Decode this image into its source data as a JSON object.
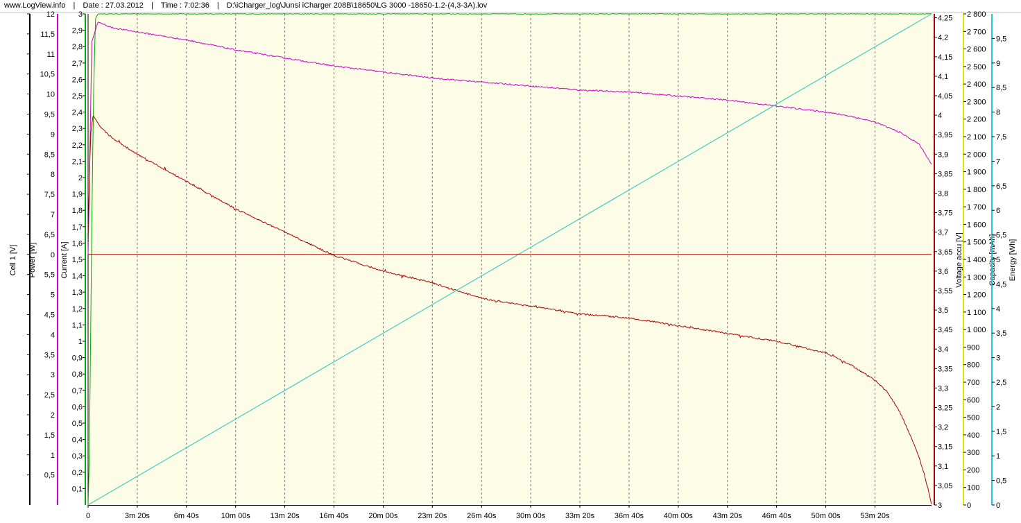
{
  "header": {
    "site": "www.LogView.info",
    "sep1": "|",
    "date": "Date : 27.03.2012",
    "sep2": "|",
    "time": "Time : 7:02:36",
    "sep3": "|",
    "file": "D:\\iCharger_log\\Junsi iCharger 208B\\18650\\LG 3000 -18650-1.2-(4,3-3A).lov"
  },
  "colors": {
    "plot_bg": "#fdfce6",
    "cell1": "#000000",
    "power": "#cc00cc",
    "current": "#00aa00",
    "voltage": "#aa0000",
    "capacity": "#e6e600",
    "energy": "#22c8e0",
    "cell1_line": "#aa0000",
    "grid": "#777777"
  },
  "chart_data": {
    "type": "line",
    "x_axis": {
      "unit": "s",
      "range": [
        0,
        3430
      ],
      "ticks": [
        {
          "value": 0,
          "label": "0"
        },
        {
          "value": 200,
          "label": "3m 20s"
        },
        {
          "value": 400,
          "label": "6m 40s"
        },
        {
          "value": 600,
          "label": "10m 00s"
        },
        {
          "value": 800,
          "label": "13m 20s"
        },
        {
          "value": 1000,
          "label": "16m 40s"
        },
        {
          "value": 1200,
          "label": "20m 00s"
        },
        {
          "value": 1400,
          "label": "23m 20s"
        },
        {
          "value": 1600,
          "label": "26m 40s"
        },
        {
          "value": 1800,
          "label": "30m 00s"
        },
        {
          "value": 2000,
          "label": "33m 20s"
        },
        {
          "value": 2200,
          "label": "36m 40s"
        },
        {
          "value": 2400,
          "label": "40m 00s"
        },
        {
          "value": 2600,
          "label": "43m 20s"
        },
        {
          "value": 2800,
          "label": "46m 40s"
        },
        {
          "value": 3000,
          "label": "50m 00s"
        },
        {
          "value": 3200,
          "label": "53m 20s"
        }
      ]
    },
    "axes": [
      {
        "id": "cell1",
        "title": "Cell 1 [V]",
        "side": "left",
        "color": "#000000",
        "range": [
          -0.25,
          12
        ],
        "ticks": [
          {
            "value": 12,
            "label": "12"
          },
          {
            "value": 11.5,
            "label": "11,5"
          },
          {
            "value": 11,
            "label": "11"
          },
          {
            "value": 10.5,
            "label": "10,5"
          },
          {
            "value": 10,
            "label": "10"
          },
          {
            "value": 9.5,
            "label": "9,5"
          },
          {
            "value": 9,
            "label": "9"
          },
          {
            "value": 8.5,
            "label": "8,5"
          },
          {
            "value": 8,
            "label": "8"
          },
          {
            "value": 7.5,
            "label": "7,5"
          },
          {
            "value": 7,
            "label": "7"
          },
          {
            "value": 6.5,
            "label": "6,5"
          },
          {
            "value": 6,
            "label": "0"
          },
          {
            "value": 5.5,
            "label": "5,5"
          },
          {
            "value": 5,
            "label": "5"
          },
          {
            "value": 4.5,
            "label": "4,5"
          },
          {
            "value": 4,
            "label": "4"
          },
          {
            "value": 3.5,
            "label": "3,5"
          },
          {
            "value": 3,
            "label": "3"
          },
          {
            "value": 2.5,
            "label": "2,5"
          },
          {
            "value": 2,
            "label": "2"
          },
          {
            "value": 1.5,
            "label": "1,5"
          },
          {
            "value": 1,
            "label": "1"
          },
          {
            "value": 0.5,
            "label": "0,5"
          }
        ]
      },
      {
        "id": "current",
        "title": "Current [A]",
        "side": "left",
        "color": "#00aa00",
        "range": [
          0,
          3
        ],
        "ticks": [
          {
            "value": 3,
            "label": "3"
          },
          {
            "value": 2.9,
            "label": "2,9"
          },
          {
            "value": 2.8,
            "label": "2,8"
          },
          {
            "value": 2.7,
            "label": "2,7"
          },
          {
            "value": 2.6,
            "label": "2,6"
          },
          {
            "value": 2.5,
            "label": "2,5"
          },
          {
            "value": 2.4,
            "label": "2,4"
          },
          {
            "value": 2.3,
            "label": "2,3"
          },
          {
            "value": 2.2,
            "label": "2,2"
          },
          {
            "value": 2.1,
            "label": "2,1"
          },
          {
            "value": 2,
            "label": "2"
          },
          {
            "value": 1.9,
            "label": "1,9"
          },
          {
            "value": 1.8,
            "label": "1,8"
          },
          {
            "value": 1.7,
            "label": "1,7"
          },
          {
            "value": 1.6,
            "label": "1,6"
          },
          {
            "value": 1.5,
            "label": "1,5"
          },
          {
            "value": 1.4,
            "label": "1,4"
          },
          {
            "value": 1.3,
            "label": "1,3"
          },
          {
            "value": 1.2,
            "label": "1,2"
          },
          {
            "value": 1.1,
            "label": "1,1"
          },
          {
            "value": 1,
            "label": "1"
          },
          {
            "value": 0.9,
            "label": "0,9"
          },
          {
            "value": 0.8,
            "label": "0,8"
          },
          {
            "value": 0.7,
            "label": "0,7"
          },
          {
            "value": 0.6,
            "label": "0,6"
          },
          {
            "value": 0.5,
            "label": "0,5"
          },
          {
            "value": 0.4,
            "label": "0,4"
          },
          {
            "value": 0.3,
            "label": "0,3"
          },
          {
            "value": 0.2,
            "label": "0,2"
          },
          {
            "value": 0.1,
            "label": "0,1"
          }
        ]
      },
      {
        "id": "power",
        "title": "Power [W]",
        "side": "left",
        "color": "#cc00cc",
        "range": [
          -0.25,
          12
        ],
        "ticks": []
      },
      {
        "id": "voltage",
        "title": "Voltage accu [V]",
        "side": "right",
        "color": "#aa0000",
        "range": [
          3,
          4.26
        ],
        "ticks": [
          {
            "value": 4.25,
            "label": "4,25"
          },
          {
            "value": 4.2,
            "label": "4,2"
          },
          {
            "value": 4.15,
            "label": "4,15"
          },
          {
            "value": 4.1,
            "label": "4,1"
          },
          {
            "value": 4.05,
            "label": "4,05"
          },
          {
            "value": 4,
            "label": "4"
          },
          {
            "value": 3.95,
            "label": "3,95"
          },
          {
            "value": 3.9,
            "label": "3,9"
          },
          {
            "value": 3.85,
            "label": "3,85"
          },
          {
            "value": 3.8,
            "label": "3,8"
          },
          {
            "value": 3.75,
            "label": "3,75"
          },
          {
            "value": 3.7,
            "label": "3,7"
          },
          {
            "value": 3.65,
            "label": "3,65"
          },
          {
            "value": 3.6,
            "label": "3,6"
          },
          {
            "value": 3.55,
            "label": "3,55"
          },
          {
            "value": 3.5,
            "label": "3,5"
          },
          {
            "value": 3.45,
            "label": "3,45"
          },
          {
            "value": 3.4,
            "label": "3,4"
          },
          {
            "value": 3.35,
            "label": "3,35"
          },
          {
            "value": 3.3,
            "label": "3,3"
          },
          {
            "value": 3.25,
            "label": "3,25"
          },
          {
            "value": 3.2,
            "label": "3,2"
          },
          {
            "value": 3.15,
            "label": "3,15"
          },
          {
            "value": 3.1,
            "label": "3,1"
          },
          {
            "value": 3.05,
            "label": "3,05"
          },
          {
            "value": 3,
            "label": "3"
          }
        ]
      },
      {
        "id": "capacity",
        "title": "Capacity [mAh]",
        "side": "right",
        "color": "#e6e600",
        "range": [
          0,
          2800
        ],
        "ticks": [
          {
            "value": 2800,
            "label": "2 800"
          },
          {
            "value": 2700,
            "label": "2 700"
          },
          {
            "value": 2600,
            "label": "2 600"
          },
          {
            "value": 2500,
            "label": "2 500"
          },
          {
            "value": 2400,
            "label": "2 400"
          },
          {
            "value": 2300,
            "label": "2 300"
          },
          {
            "value": 2200,
            "label": "2 200"
          },
          {
            "value": 2100,
            "label": "2 100"
          },
          {
            "value": 2000,
            "label": "2 000"
          },
          {
            "value": 1900,
            "label": "1 900"
          },
          {
            "value": 1800,
            "label": "1 800"
          },
          {
            "value": 1700,
            "label": "1 700"
          },
          {
            "value": 1600,
            "label": "1 600"
          },
          {
            "value": 1500,
            "label": "1 500"
          },
          {
            "value": 1400,
            "label": "1 400"
          },
          {
            "value": 1300,
            "label": "1 300"
          },
          {
            "value": 1200,
            "label": "1 200"
          },
          {
            "value": 1100,
            "label": "1 100"
          },
          {
            "value": 1000,
            "label": "1 000"
          },
          {
            "value": 900,
            "label": "900"
          },
          {
            "value": 800,
            "label": "800"
          },
          {
            "value": 700,
            "label": "700"
          },
          {
            "value": 600,
            "label": "600"
          },
          {
            "value": 500,
            "label": "500"
          },
          {
            "value": 400,
            "label": "400"
          },
          {
            "value": 300,
            "label": "300"
          },
          {
            "value": 200,
            "label": "200"
          },
          {
            "value": 100,
            "label": "100"
          },
          {
            "value": 0,
            "label": "0"
          }
        ]
      },
      {
        "id": "energy",
        "title": "Energy [Wh]",
        "side": "right",
        "color": "#22c8e0",
        "range": [
          0,
          10
        ],
        "ticks": [
          {
            "value": 9.5,
            "label": "9,5"
          },
          {
            "value": 9,
            "label": "9"
          },
          {
            "value": 8.5,
            "label": "8,5"
          },
          {
            "value": 8,
            "label": "8"
          },
          {
            "value": 7.5,
            "label": "7,5"
          },
          {
            "value": 7,
            "label": "7"
          },
          {
            "value": 6.5,
            "label": "6,5"
          },
          {
            "value": 6,
            "label": "6"
          },
          {
            "value": 5.5,
            "label": "5,5"
          },
          {
            "value": 5,
            "label": "5"
          },
          {
            "value": 4.5,
            "label": "4,5"
          },
          {
            "value": 4,
            "label": "4"
          },
          {
            "value": 3.5,
            "label": "3,5"
          },
          {
            "value": 3,
            "label": "3"
          },
          {
            "value": 2.5,
            "label": "2,5"
          },
          {
            "value": 2,
            "label": "2"
          },
          {
            "value": 1.5,
            "label": "1,5"
          },
          {
            "value": 1,
            "label": "1"
          },
          {
            "value": 0.5,
            "label": "0,5"
          },
          {
            "value": 0,
            "label": "0"
          }
        ]
      }
    ],
    "series": [
      {
        "id": "current",
        "axis": "current",
        "color": "#00aa00",
        "x": [
          0,
          5,
          10,
          15,
          20,
          25,
          30,
          40,
          3430
        ],
        "y": [
          0,
          0.3,
          1.0,
          1.7,
          2.3,
          2.7,
          2.97,
          3.0,
          3.0
        ]
      },
      {
        "id": "power",
        "axis": "power",
        "color": "#cc00cc",
        "x": [
          0,
          15,
          40,
          100,
          200,
          400,
          600,
          800,
          1000,
          1200,
          1400,
          1600,
          1800,
          2000,
          2200,
          2400,
          2600,
          2800,
          3000,
          3100,
          3200,
          3300,
          3380,
          3430
        ],
        "y": [
          6.0,
          11.3,
          11.8,
          11.65,
          11.55,
          11.35,
          11.1,
          10.9,
          10.7,
          10.55,
          10.4,
          10.3,
          10.2,
          10.1,
          10.05,
          9.95,
          9.85,
          9.7,
          9.55,
          9.45,
          9.3,
          9.05,
          8.75,
          8.25
        ]
      },
      {
        "id": "voltage",
        "axis": "voltage",
        "color": "#aa0000",
        "x": [
          0,
          10,
          20,
          50,
          100,
          200,
          400,
          600,
          800,
          1000,
          1200,
          1400,
          1600,
          1800,
          2000,
          2200,
          2400,
          2600,
          2800,
          3000,
          3100,
          3200,
          3250,
          3300,
          3350,
          3380,
          3400,
          3420,
          3430
        ],
        "y": [
          3.7,
          3.95,
          4.0,
          3.97,
          3.94,
          3.9,
          3.83,
          3.76,
          3.7,
          3.64,
          3.6,
          3.57,
          3.53,
          3.51,
          3.49,
          3.48,
          3.46,
          3.44,
          3.42,
          3.39,
          3.36,
          3.32,
          3.29,
          3.24,
          3.17,
          3.12,
          3.08,
          3.03,
          3.0
        ]
      },
      {
        "id": "capacity",
        "axis": "capacity",
        "color": "#e6e600",
        "x": [
          0,
          3430
        ],
        "y": [
          0,
          2800
        ]
      },
      {
        "id": "energy",
        "axis": "energy",
        "color": "#22c8e0",
        "x": [
          0,
          3430
        ],
        "y": [
          0,
          10
        ]
      },
      {
        "id": "cell1",
        "axis": "cell1",
        "color": "#aa0000",
        "x": [
          0,
          3430
        ],
        "y": [
          6.0,
          6.0
        ]
      }
    ],
    "grid": true
  }
}
